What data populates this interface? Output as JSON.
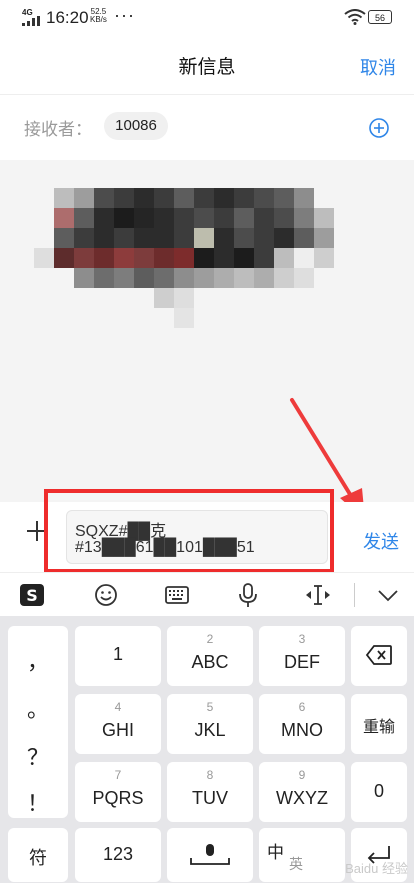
{
  "status_bar": {
    "network": "4G",
    "time": "16:20",
    "speed_value": "52.5",
    "speed_unit": "KB/s",
    "more": "···",
    "battery": "56"
  },
  "header": {
    "title": "新信息",
    "cancel": "取消"
  },
  "recipient": {
    "label": "接收者：",
    "chip": "10086"
  },
  "compose": {
    "line1": "SQXZ#██克",
    "line2": "#13███61██101███51",
    "send": "发送"
  },
  "keyboard": {
    "punctuation": [
      "，",
      "。",
      "？",
      "！"
    ],
    "keys": [
      {
        "sub": "",
        "main": "1"
      },
      {
        "sub": "2",
        "main": "ABC"
      },
      {
        "sub": "3",
        "main": "DEF"
      },
      {
        "sub": "4",
        "main": "GHI"
      },
      {
        "sub": "5",
        "main": "JKL"
      },
      {
        "sub": "6",
        "main": "MNO"
      },
      {
        "sub": "7",
        "main": "PQRS"
      },
      {
        "sub": "8",
        "main": "TUV"
      },
      {
        "sub": "9",
        "main": "WXYZ"
      }
    ],
    "reinput": "重输",
    "zero": "0",
    "symbol": "符",
    "num": "123",
    "lang_cn": "中",
    "lang_en": "英"
  },
  "watermark": "Baidu 经验",
  "colors": {
    "accent": "#2f86e8",
    "highlight": "#ee2c2c",
    "keyboard_bg": "#e6e6e9"
  }
}
